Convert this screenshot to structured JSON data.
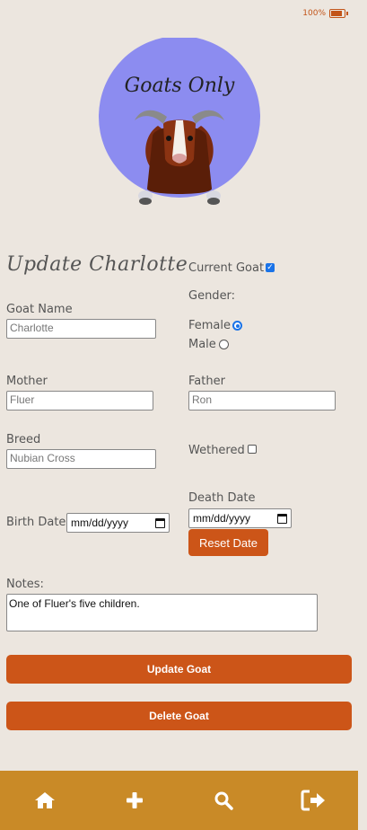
{
  "status": {
    "battery_text": "100%",
    "battery_level": 1.0
  },
  "logo": {
    "text": "Goats Only",
    "circle_color": "#8c8cf0"
  },
  "form": {
    "title": "Update Charlotte",
    "current_goat": {
      "label": "Current Goat",
      "checked": true
    },
    "gender": {
      "label": "Gender:",
      "female_label": "Female",
      "male_label": "Male",
      "selected": "Female"
    },
    "goat_name": {
      "label": "Goat Name",
      "value": "Charlotte"
    },
    "mother": {
      "label": "Mother",
      "value": "Fluer"
    },
    "father": {
      "label": "Father",
      "value": "Ron"
    },
    "breed": {
      "label": "Breed",
      "value": "Nubian Cross"
    },
    "wethered": {
      "label": "Wethered",
      "checked": false
    },
    "death_date": {
      "label": "Death Date",
      "value": "mm/dd/yyyy"
    },
    "reset_date": "Reset Date",
    "birth_date": {
      "label": "Birth Date",
      "value": "mm/dd/yyyy"
    },
    "notes": {
      "label": "Notes:",
      "value": "One of Fluer's five children."
    },
    "update_button": "Update Goat",
    "delete_button": "Delete Goat"
  },
  "nav": {
    "background": "#c98a27",
    "items": [
      "home-icon",
      "plus-icon",
      "search-icon",
      "logout-icon"
    ]
  },
  "colors": {
    "accent": "#cc5518",
    "background": "#ece6df"
  }
}
